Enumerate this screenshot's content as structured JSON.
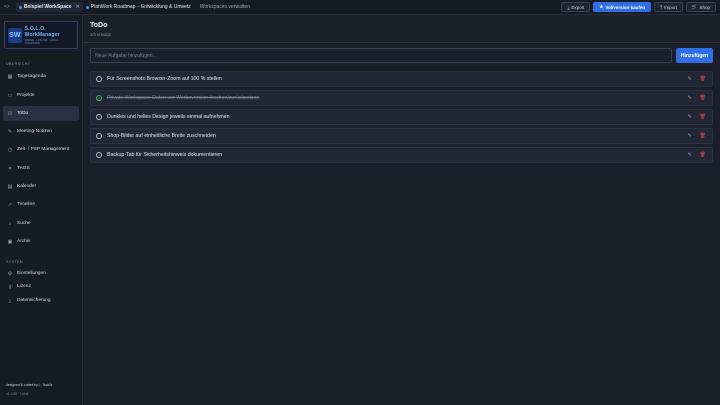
{
  "topbar": {
    "chevron": "<>",
    "tabs": [
      {
        "label": "Beispiel WorkSpace",
        "active": true
      },
      {
        "label": "PlanWerk Roadmap – Entwicklung & Umsetz",
        "active": false
      }
    ],
    "manage_label": "Workspaces verwalten",
    "buttons": {
      "export": "Export",
      "full": "Vollversion kaufen",
      "import": "Import",
      "shop": "Shop"
    }
  },
  "logo": {
    "mark": "SW",
    "title": "S.O.L.O. WorkManager",
    "subtitle": "SIMPLE · OFFLINE · LOCAL · ORGANIZED"
  },
  "sidebar": {
    "section_main": "ÜBERSICHT",
    "items": [
      {
        "label": "Tagesagenda",
        "icon": "calendar-day-icon",
        "glyph": "▦"
      },
      {
        "label": "Projekte",
        "icon": "folder-icon",
        "glyph": "▭"
      },
      {
        "label": "ToDo",
        "icon": "checklist-icon",
        "glyph": "☑"
      },
      {
        "label": "Meeting-Notizen",
        "icon": "chat-icon",
        "glyph": "✎"
      },
      {
        "label": "Zeit- / PSP Management",
        "icon": "clock-icon",
        "glyph": "◷"
      },
      {
        "label": "TAGS",
        "icon": "tag-icon",
        "glyph": "⌗"
      },
      {
        "label": "Kalender",
        "icon": "calendar-icon",
        "glyph": "▤"
      },
      {
        "label": "Timeline",
        "icon": "timeline-icon",
        "glyph": "↗"
      },
      {
        "label": "Suche",
        "icon": "search-icon",
        "glyph": "⌕"
      },
      {
        "label": "Archiv",
        "icon": "archive-icon",
        "glyph": "▣"
      }
    ],
    "section_system": "SYSTEM",
    "system_items": [
      {
        "label": "Einstellungen",
        "icon": "gear-icon",
        "glyph": "⚙"
      },
      {
        "label": "Lizenz",
        "icon": "key-icon",
        "glyph": "⚷"
      },
      {
        "label": "Datensicherung",
        "icon": "download-icon",
        "glyph": "⤓"
      }
    ],
    "credits": "designed & coded by L. Tschilz",
    "version": "v1.0.88 · Lokal"
  },
  "main": {
    "title": "ToDo",
    "subtitle": "1/5 erledigt",
    "add_placeholder": "Neue Aufgabe hinzufügen...",
    "add_button": "Hinzufügen",
    "todos": [
      {
        "text": "Für Screenshots Browser-Zoom auf 100 % stellen",
        "done": false
      },
      {
        "text": "Private Workspace-Daten vor Werbeversion löschen/zurücksetzen",
        "done": true
      },
      {
        "text": "Dunkles und helles Design jeweils einmal aufnehmen",
        "done": false
      },
      {
        "text": "Shop-Bilder auf einheitliche Breite zuschneiden",
        "done": false
      },
      {
        "text": "Backup-Tab für Sicherheitshinweis dokumentieren",
        "done": false
      }
    ]
  },
  "colors": {
    "accent": "#2f6ee5",
    "done": "#22c55e",
    "danger": "#e5484d"
  }
}
